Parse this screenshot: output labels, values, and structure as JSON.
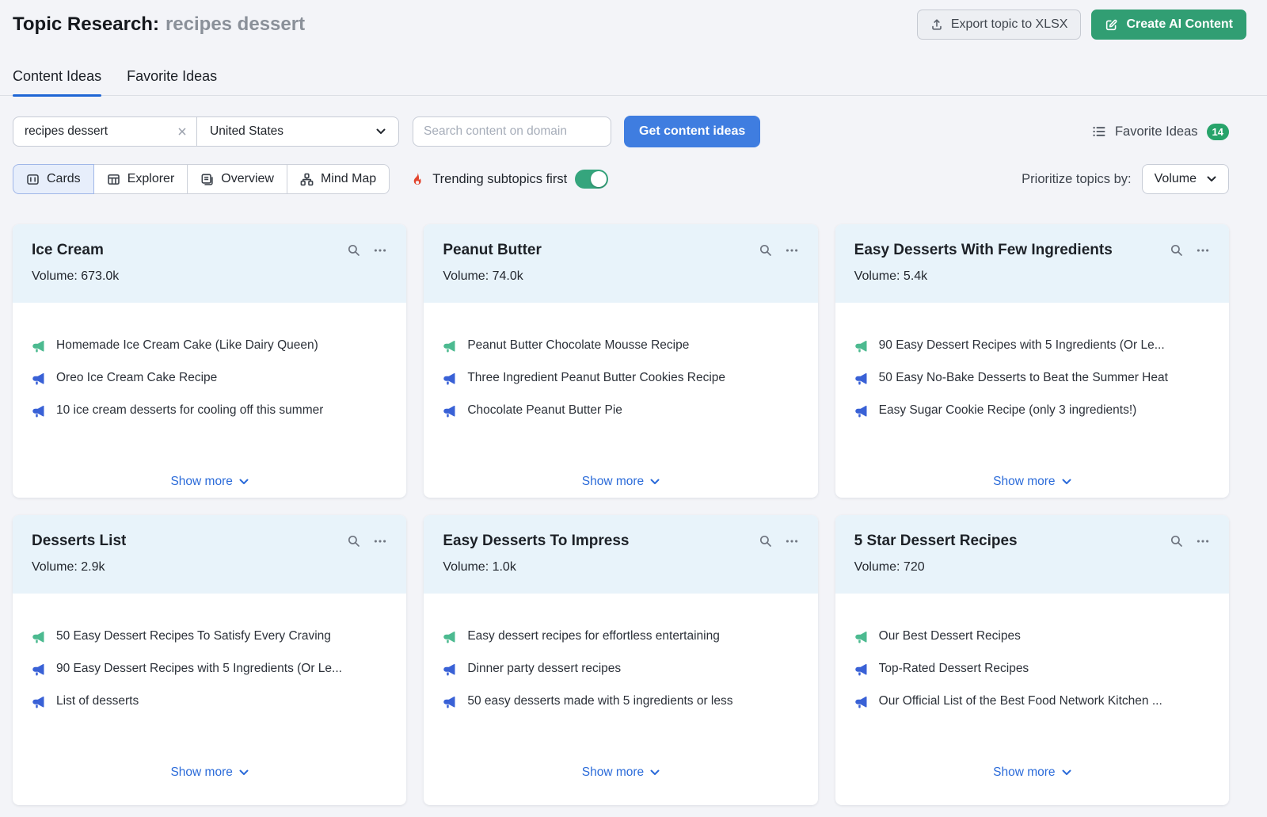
{
  "header": {
    "title": "Topic Research:",
    "query": "recipes dessert",
    "export_button": "Export topic to XLSX",
    "create_ai_button": "Create AI Content"
  },
  "tabs": [
    {
      "label": "Content Ideas",
      "active": true
    },
    {
      "label": "Favorite Ideas",
      "active": false
    }
  ],
  "search": {
    "query_value": "recipes dessert",
    "country_value": "United States",
    "domain_placeholder": "Search content on domain",
    "submit_label": "Get content ideas",
    "favorite_ideas_label": "Favorite Ideas",
    "favorite_ideas_count": "14"
  },
  "view_bar": {
    "views": [
      "Cards",
      "Explorer",
      "Overview",
      "Mind Map"
    ],
    "active_view": "Cards",
    "trending_label": "Trending subtopics first",
    "trending_on": true,
    "prioritize_label": "Prioritize topics by:",
    "prioritize_value": "Volume"
  },
  "card_ui": {
    "show_more": "Show more"
  },
  "cards": [
    {
      "title": "Ice Cream",
      "volume_text": "Volume: 673.0k",
      "items": [
        {
          "text": "Homemade Ice Cream Cake (Like Dairy Queen)",
          "color": "green"
        },
        {
          "text": "Oreo Ice Cream Cake Recipe",
          "color": "blue"
        },
        {
          "text": "10 ice cream desserts for cooling off this summer",
          "color": "blue"
        }
      ]
    },
    {
      "title": "Peanut Butter",
      "volume_text": "Volume: 74.0k",
      "items": [
        {
          "text": "Peanut Butter Chocolate Mousse Recipe",
          "color": "green"
        },
        {
          "text": "Three Ingredient Peanut Butter Cookies Recipe",
          "color": "blue"
        },
        {
          "text": "Chocolate Peanut Butter Pie",
          "color": "blue"
        }
      ]
    },
    {
      "title": "Easy Desserts With Few Ingredients",
      "volume_text": "Volume: 5.4k",
      "items": [
        {
          "text": "90 Easy Dessert Recipes with 5 Ingredients (Or Le...",
          "color": "green"
        },
        {
          "text": "50 Easy No-Bake Desserts to Beat the Summer Heat",
          "color": "blue"
        },
        {
          "text": "Easy Sugar Cookie Recipe (only 3 ingredients!)",
          "color": "blue"
        }
      ]
    },
    {
      "title": "Desserts List",
      "volume_text": "Volume: 2.9k",
      "items": [
        {
          "text": "50 Easy Dessert Recipes To Satisfy Every Craving",
          "color": "green"
        },
        {
          "text": "90 Easy Dessert Recipes with 5 Ingredients (Or Le...",
          "color": "blue"
        },
        {
          "text": "List of desserts",
          "color": "blue"
        }
      ]
    },
    {
      "title": "Easy Desserts To Impress",
      "volume_text": "Volume: 1.0k",
      "items": [
        {
          "text": "Easy dessert recipes for effortless entertaining",
          "color": "green"
        },
        {
          "text": "Dinner party dessert recipes",
          "color": "blue"
        },
        {
          "text": "50 easy desserts made with 5 ingredients or less",
          "color": "blue"
        }
      ]
    },
    {
      "title": "5 Star Dessert Recipes",
      "volume_text": "Volume: 720",
      "items": [
        {
          "text": "Our Best Dessert Recipes",
          "color": "green"
        },
        {
          "text": "Top-Rated Dessert Recipes",
          "color": "blue"
        },
        {
          "text": "Our Official List of the Best Food Network Kitchen ...",
          "color": "blue"
        }
      ]
    }
  ],
  "icons": {
    "export": "upload-icon",
    "create_ai": "pencil-square-icon",
    "clear_query": "close-icon",
    "country": "chevron-down-icon",
    "favorites": "list-icon",
    "views": [
      "cards-icon",
      "table-icon",
      "overview-icon",
      "mind-map-icon"
    ],
    "trending": "flame-icon",
    "card_actions": [
      "search-icon",
      "ellipsis-icon"
    ],
    "headline": "megaphone-icon"
  },
  "colors": {
    "page_bg": "#f3f4f8",
    "accent_blue": "#3f7de0",
    "link_blue": "#2b6bd9",
    "tab_underline": "#1f66d5",
    "green_button": "#319e73",
    "badge_green": "#27a36a",
    "toggle_green": "#35a57d",
    "flame_red": "#e2452e",
    "megaphone_green": "#4cba90",
    "megaphone_blue": "#3961d6",
    "card_header_bg": "#e8f3fa"
  }
}
